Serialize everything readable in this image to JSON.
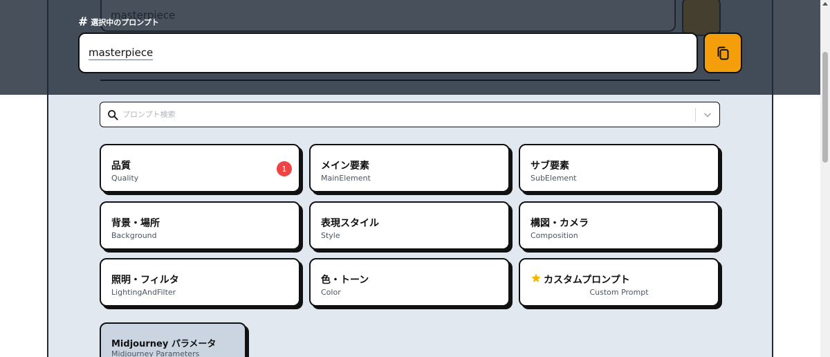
{
  "selected": {
    "label": "選択中のプロンプト",
    "hash_icon": "#",
    "value": "masterpiece",
    "copy_icon": "copy-icon"
  },
  "background_input": {
    "value": "masterpiece"
  },
  "search": {
    "placeholder": "プロンプト検索"
  },
  "categories": [
    {
      "title": "品質",
      "subtitle": "Quality",
      "badge": "1"
    },
    {
      "title": "メイン要素",
      "subtitle": "MainElement"
    },
    {
      "title": "サブ要素",
      "subtitle": "SubElement"
    },
    {
      "title": "背景・場所",
      "subtitle": "Background"
    },
    {
      "title": "表現スタイル",
      "subtitle": "Style"
    },
    {
      "title": "構図・カメラ",
      "subtitle": "Composition"
    },
    {
      "title": "照明・フィルタ",
      "subtitle": "LightingAndFilter"
    },
    {
      "title": "色・トーン",
      "subtitle": "Color"
    },
    {
      "title": "カスタムプロンプト",
      "subtitle": "Custom Prompt",
      "icon": "star-icon"
    }
  ],
  "midjourney": {
    "title": "Midjourney パラメータ",
    "subtitle": "Midjourney Parameters"
  },
  "colors": {
    "accent": "#f59e0b",
    "badge": "#ef4444",
    "panel": "#e2e8f0",
    "star": "#f5b800"
  }
}
